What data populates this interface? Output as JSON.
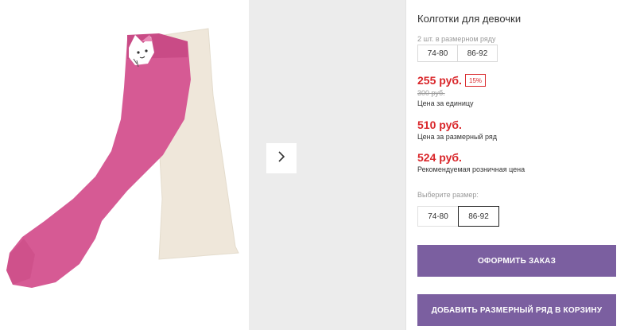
{
  "product": {
    "title": "Колготки для девочки",
    "series_label": "2 шт. в размерном ряду",
    "series_sizes": [
      "74-80",
      "86-92"
    ]
  },
  "pricing": {
    "unit_price": "255 руб.",
    "discount": "15%",
    "old_price": "300 руб.",
    "unit_caption": "Цена за единицу",
    "series_price": "510 руб.",
    "series_caption": "Цена за размерный ряд",
    "retail_price": "524 руб.",
    "retail_caption": "Рекомендуемая розничная цена"
  },
  "size_picker": {
    "label": "Выберите размер:",
    "options": [
      "74-80",
      "86-92"
    ],
    "selected": "86-92"
  },
  "actions": {
    "order_label": "ОФОРМИТЬ ЗАКАЗ",
    "add_series_label": "ДОБАВИТЬ РАЗМЕРНЫЙ РЯД В КОРЗИНУ"
  },
  "icons": {
    "gallery_next": "chevron-right-icon"
  },
  "colors": {
    "price": "#d9262a",
    "button": "#7b5fa0",
    "tights_pink": "#d65a94",
    "tights_beige": "#efe7da"
  }
}
